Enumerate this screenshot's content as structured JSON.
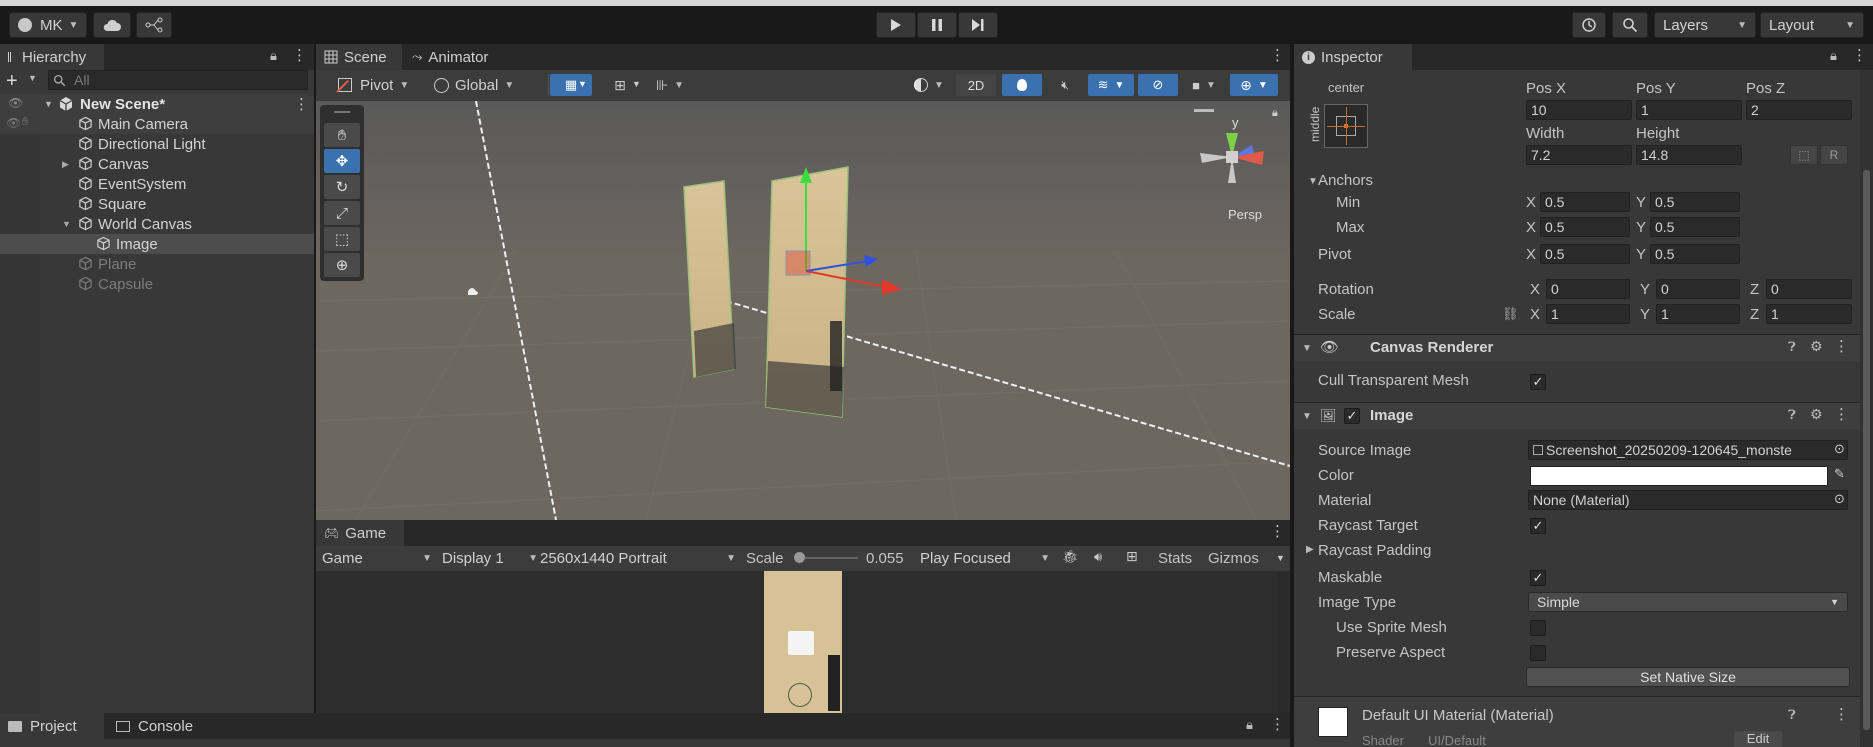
{
  "toolbar": {
    "account": "MK",
    "layers": "Layers",
    "layout": "Layout"
  },
  "hierarchy": {
    "tab": "Hierarchy",
    "search_placeholder": "All",
    "scene": "New Scene*",
    "items": [
      {
        "label": "Main Camera"
      },
      {
        "label": "Directional Light"
      },
      {
        "label": "Canvas"
      },
      {
        "label": "EventSystem"
      },
      {
        "label": "Square"
      },
      {
        "label": "World Canvas"
      },
      {
        "label": "Image"
      },
      {
        "label": "Plane"
      },
      {
        "label": "Capsule"
      }
    ]
  },
  "scene": {
    "tabs": [
      "Scene",
      "Animator"
    ],
    "pivot": "Pivot",
    "global": "Global",
    "btn_2d": "2D",
    "persp": "Persp",
    "gizmo_y": "y"
  },
  "game": {
    "tab": "Game",
    "mode": "Game",
    "display": "Display 1",
    "resolution": "2560x1440 Portrait",
    "scale_label": "Scale",
    "scale_value": "0.055",
    "play_focused": "Play Focused",
    "stats": "Stats",
    "gizmos": "Gizmos"
  },
  "bottom_tabs": [
    "Project",
    "Console"
  ],
  "inspector": {
    "tab": "Inspector",
    "anchor_preset_top": "center",
    "anchor_preset_side": "middle",
    "pos_x_label": "Pos X",
    "pos_x": "10",
    "pos_y_label": "Pos Y",
    "pos_y": "1",
    "pos_z_label": "Pos Z",
    "pos_z": "2",
    "width_label": "Width",
    "width": "7.2",
    "height_label": "Height",
    "height": "14.8",
    "anchors": "Anchors",
    "min": "Min",
    "max": "Max",
    "pivot": "Pivot",
    "rotation": "Rotation",
    "scale": "Scale",
    "x": "X",
    "y": "Y",
    "z": "Z",
    "anchor_min_x": "0.5",
    "anchor_min_y": "0.5",
    "anchor_max_x": "0.5",
    "anchor_max_y": "0.5",
    "pivot_x": "0.5",
    "pivot_y": "0.5",
    "rot_x": "0",
    "rot_y": "0",
    "rot_z": "0",
    "scale_x": "1",
    "scale_y": "1",
    "scale_z": "1",
    "canvas_renderer": "Canvas Renderer",
    "cull_transparent_mesh": "Cull Transparent Mesh",
    "image_component": "Image",
    "source_image_label": "Source Image",
    "source_image": "Screenshot_20250209-120645_monste",
    "color_label": "Color",
    "material_label": "Material",
    "material": "None (Material)",
    "raycast_target": "Raycast Target",
    "raycast_padding": "Raycast Padding",
    "maskable": "Maskable",
    "image_type_label": "Image Type",
    "image_type": "Simple",
    "use_sprite_mesh": "Use Sprite Mesh",
    "preserve_aspect": "Preserve Aspect",
    "set_native_size": "Set Native Size",
    "default_material": "Default UI Material (Material)",
    "shader_label": "Shader",
    "shader_value": "UI/Default",
    "edit": "Edit"
  },
  "colors": {
    "bg_dark": "#191919",
    "panel": "#383838",
    "accent_blue": "#3a72b0",
    "selected_row": "#4d4d4d"
  }
}
